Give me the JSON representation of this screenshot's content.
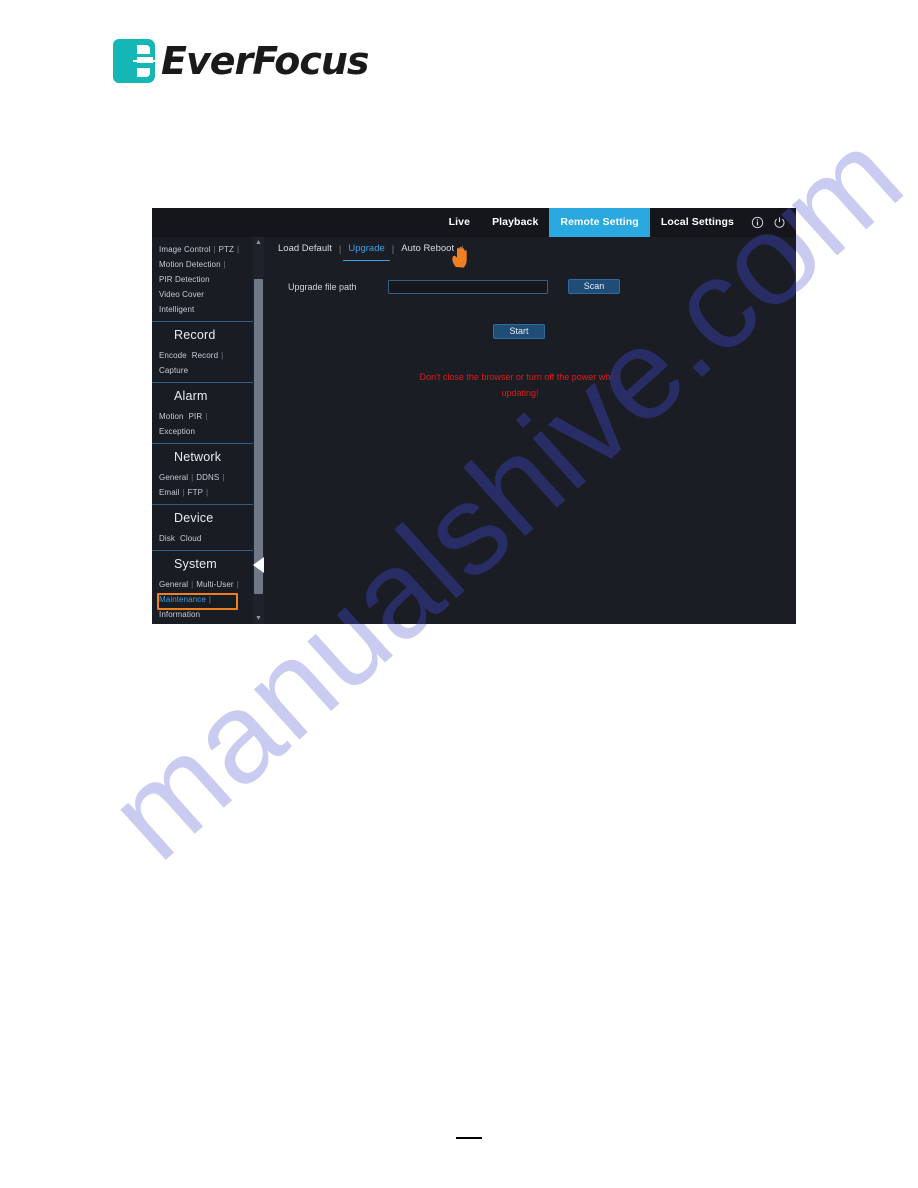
{
  "brand": {
    "name": "EverFocus",
    "logo_color": "#15b6b6"
  },
  "watermark": {
    "text": "manualshive.com",
    "page_color": "#c9cbf0",
    "app_color": "#2b2f6b"
  },
  "app": {
    "topbar": {
      "items": [
        {
          "label": "Live",
          "active": false
        },
        {
          "label": "Playback",
          "active": false
        },
        {
          "label": "Remote Setting",
          "active": true
        },
        {
          "label": "Local Settings",
          "active": false
        }
      ],
      "info_icon": "info-circle-icon",
      "power_icon": "power-icon",
      "active_color": "#29a9e0"
    },
    "sidebar": {
      "sections": [
        {
          "title": "",
          "rows": [
            {
              "links": [
                "Image Control",
                "PTZ"
              ],
              "trailing_sep": true
            },
            {
              "links": [
                "Motion Detection"
              ],
              "trailing_sep": true
            },
            {
              "links": [
                "PIR Detection"
              ],
              "trailing_sep": false
            },
            {
              "links": [
                "Video Cover"
              ],
              "trailing_sep": false
            },
            {
              "links": [
                "Intelligent"
              ],
              "trailing_sep": false
            }
          ]
        },
        {
          "title": "Record",
          "rows": [
            {
              "links": [
                "Encode",
                "Record"
              ],
              "trailing_sep": true,
              "space_sep": true
            },
            {
              "links": [
                "Capture"
              ],
              "trailing_sep": false
            }
          ]
        },
        {
          "title": "Alarm",
          "rows": [
            {
              "links": [
                "Motion",
                "PIR"
              ],
              "trailing_sep": true,
              "space_sep": true
            },
            {
              "links": [
                "Exception"
              ],
              "trailing_sep": false
            }
          ]
        },
        {
          "title": "Network",
          "rows": [
            {
              "links": [
                "General",
                "DDNS"
              ],
              "trailing_sep": true
            },
            {
              "links": [
                "Email",
                "FTP"
              ],
              "trailing_sep": true
            }
          ]
        },
        {
          "title": "Device",
          "rows": [
            {
              "links": [
                "Disk",
                "Cloud"
              ],
              "trailing_sep": false,
              "space_sep": true
            }
          ]
        },
        {
          "title": "System",
          "rows": [
            {
              "links": [
                "General",
                "Multi-User"
              ],
              "trailing_sep": true
            },
            {
              "links": [
                "Maintenance"
              ],
              "trailing_sep": true,
              "marked": true
            },
            {
              "links": [
                "Information"
              ],
              "trailing_sep": false
            }
          ]
        }
      ],
      "highlight_color": "#ef8022",
      "scroll_up_icon": "chevron-up-icon",
      "scroll_down_icon": "chevron-down-icon"
    },
    "content": {
      "tabs": [
        {
          "label": "Load Default",
          "active": false
        },
        {
          "label": "Upgrade",
          "active": true
        },
        {
          "label": "Auto Reboot",
          "active": false
        }
      ],
      "cursor_icon": "hand-pointer-icon",
      "form": {
        "path_label": "Upgrade file path",
        "path_value": "",
        "path_placeholder": "",
        "scan_label": "Scan",
        "start_label": "Start"
      },
      "warning_line1": "Don't close the browser or turn off the power when",
      "warning_line2": "updating!",
      "warning_color": "#e01b18"
    }
  }
}
